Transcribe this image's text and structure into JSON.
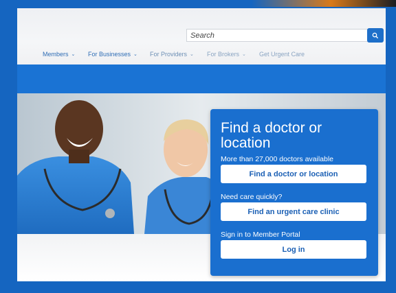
{
  "search": {
    "placeholder": "Search",
    "button_icon": "search-icon"
  },
  "nav": {
    "items": [
      {
        "label": "Members",
        "chevron": "⌄"
      },
      {
        "label": "For Businesses",
        "chevron": "⌄"
      },
      {
        "label": "For Providers",
        "chevron": "⌄"
      },
      {
        "label": "For Brokers",
        "chevron": "⌄"
      },
      {
        "label": "Get Urgent Care"
      }
    ]
  },
  "panel": {
    "title": "Find a doctor or location",
    "doctors_text": "More than 27,000 doctors available",
    "find_doctor_button": "Find a doctor or location",
    "care_quickly_text": "Need care quickly?",
    "urgent_care_button": "Find an urgent care clinic",
    "sign_in_text": "Sign in to Member Portal",
    "login_button": "Log in"
  },
  "colors": {
    "brand_blue": "#1a6fcf",
    "nav_blue": "#2f6db5",
    "background_blue": "#1565c0"
  }
}
